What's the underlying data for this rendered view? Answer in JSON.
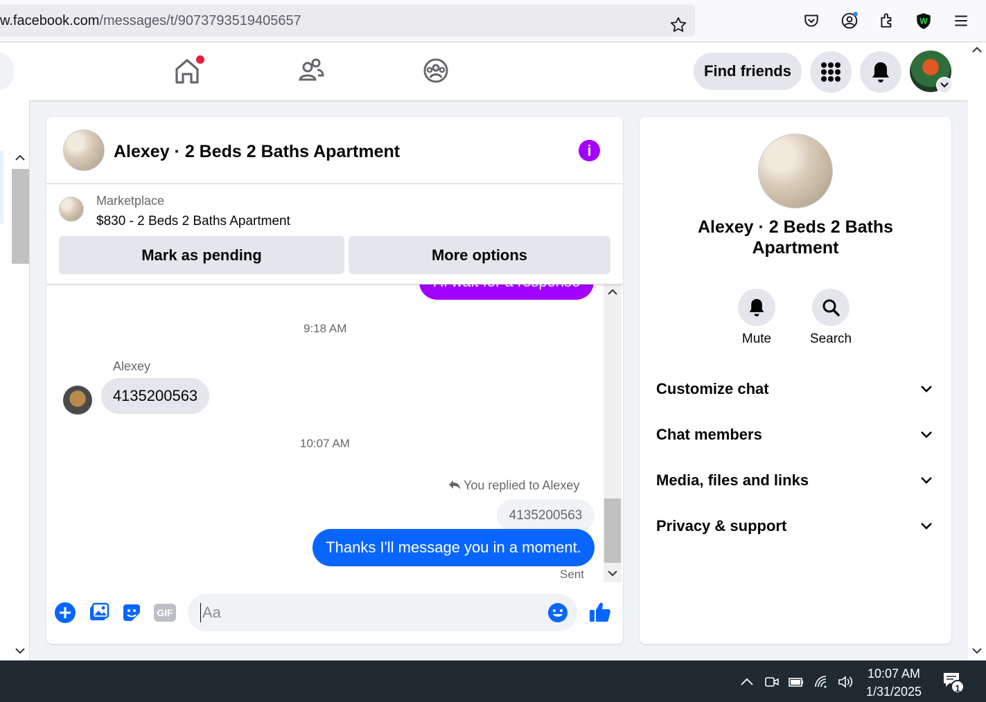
{
  "browser": {
    "url_prefix": "w.facebook.com",
    "url_path": "/messages/t/9073793519405657"
  },
  "nav": {
    "find_friends": "Find friends"
  },
  "chat": {
    "title": "Alexey · 2 Beds 2 Baths Apartment",
    "marketplace_label": "Marketplace",
    "listing": "$830 - 2 Beds 2 Baths Apartment",
    "mark_pending": "Mark as pending",
    "more_options": "More options",
    "purple_message": "Hi wait for a response",
    "time1": "9:18 AM",
    "sender": "Alexey",
    "incoming_message": "4135200563",
    "time2": "10:07 AM",
    "replied_note": "You replied to Alexey",
    "quoted_message": "4135200563",
    "outgoing_message": "Thanks I'll message you in a moment.",
    "status": "Sent",
    "input_placeholder": "Aa",
    "gif_label": "GIF"
  },
  "info_panel": {
    "title": "Alexey · 2 Beds 2 Baths Apartment",
    "mute": "Mute",
    "search": "Search",
    "sections": [
      "Customize chat",
      "Chat members",
      "Media, files and links",
      "Privacy & support"
    ]
  },
  "taskbar": {
    "time": "10:07 AM",
    "date": "1/31/2025",
    "notification_count": "1"
  },
  "colors": {
    "accent_blue": "#0866ff",
    "purple": "#a200ff"
  }
}
